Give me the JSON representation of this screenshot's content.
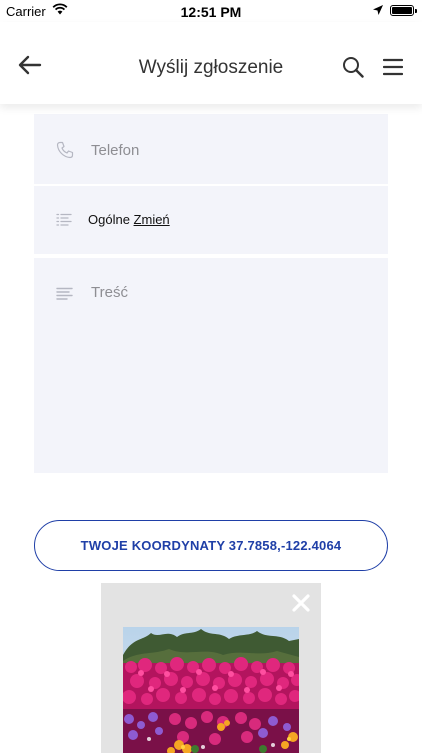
{
  "status_bar": {
    "carrier": "Carrier",
    "time": "12:51 PM",
    "wifi_icon": "wifi-icon",
    "location_icon": "location-arrow-icon",
    "battery_icon": "battery-icon"
  },
  "nav": {
    "title": "Wyślij zgłoszenie",
    "back_icon": "arrow-left-icon",
    "search_icon": "search-icon",
    "menu_icon": "hamburger-menu-icon"
  },
  "form": {
    "phone_placeholder": "Telefon",
    "category_value": "Ogólne",
    "category_change": "Zmień",
    "content_placeholder": "Treść",
    "phone_icon": "phone-icon",
    "category_icon": "list-icon",
    "content_icon": "text-lines-icon"
  },
  "coordinates_button": {
    "label": "TWOJE KOORDYNATY 37.7858,-122.4064"
  },
  "photo": {
    "close_icon": "close-icon",
    "image": "flowers-photo"
  },
  "colors": {
    "accent": "#1f3fa7",
    "field_bg": "#f3f4fa",
    "placeholder": "#8e8e93"
  }
}
